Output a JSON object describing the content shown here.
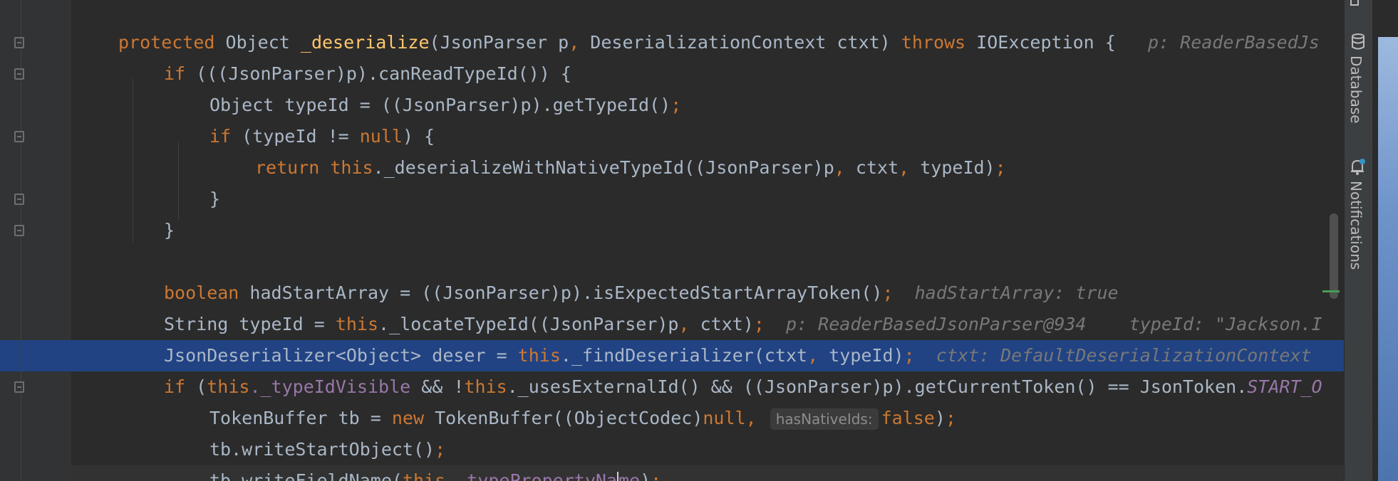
{
  "code": {
    "l1": {
      "kw1": "protected",
      "t1": " Object ",
      "fn": "_deserialize",
      "t2": "(JsonParser p",
      "p1": ",",
      "t3": " DeserializationContext ctxt) ",
      "kw2": "throws",
      "t4": " IOException {",
      "hint": "p: ReaderBasedJs"
    },
    "l2": {
      "kw1": "if",
      "t1": " (((JsonParser)p).canReadTypeId()) {"
    },
    "l3": {
      "t1": "Object typeId = ((JsonParser)p).getTypeId()",
      "semi": ";"
    },
    "l4": {
      "kw1": "if",
      "t1": " (typeId != ",
      "kw2": "null",
      "t2": ") {"
    },
    "l5": {
      "kw1": "return",
      "kw2": " this",
      "t1": "._deserializeWithNativeTypeId((JsonParser)p",
      "c1": ",",
      "t2": " ctxt",
      "c2": ",",
      "t3": " typeId)",
      "semi": ";"
    },
    "l6": {
      "t1": "}"
    },
    "l7": {
      "t1": "}"
    },
    "l9": {
      "kw1": "boolean",
      "t1": " hadStartArray = ((JsonParser)p).isExpectedStartArrayToken()",
      "semi": ";",
      "hint": "hadStartArray: true"
    },
    "l10": {
      "t1": "String typeId = ",
      "kw1": "this",
      "t2": "._locateTypeId((JsonParser)p",
      "c1": ",",
      "t3": " ctxt)",
      "semi": ";",
      "hint1": "p: ReaderBasedJsonParser@934",
      "hint2": "typeId: \"Jackson.I"
    },
    "l11": {
      "t1": "JsonDeserializer<Object> deser = ",
      "kw1": "this",
      "t2": "._findDeserializer(ctxt",
      "c1": ",",
      "t3": " typeId)",
      "semi": ";",
      "hint": "ctxt: DefaultDeserializationContext"
    },
    "l12": {
      "kw1": "if",
      "t1": " (",
      "kw2": "this",
      "f1": "._typeIdVisible",
      "t2": " && !",
      "kw3": "this",
      "t3": "._usesExternalId() && ((JsonParser)p).getCurrentToken() == JsonToken.",
      "cst": "START_O"
    },
    "l13": {
      "t1": "TokenBuffer tb = ",
      "kw1": "new",
      "t2": " TokenBuffer((ObjectCodec)",
      "kw2": "null",
      "c1": ",",
      "param": "hasNativeIds:",
      "kw3": "false",
      "t3": ")",
      "semi": ";"
    },
    "l14": {
      "t1": "tb.writeStartObject()",
      "semi": ";"
    },
    "l15": {
      "t1": "tb.writeFieldName(",
      "kw1": "this",
      "f1": "._typePropertyNa",
      "f2": "me",
      "t2": ")",
      "semi": ";"
    }
  },
  "sidebar": {
    "database_label": "Database",
    "notifications_label": "Notifications"
  }
}
